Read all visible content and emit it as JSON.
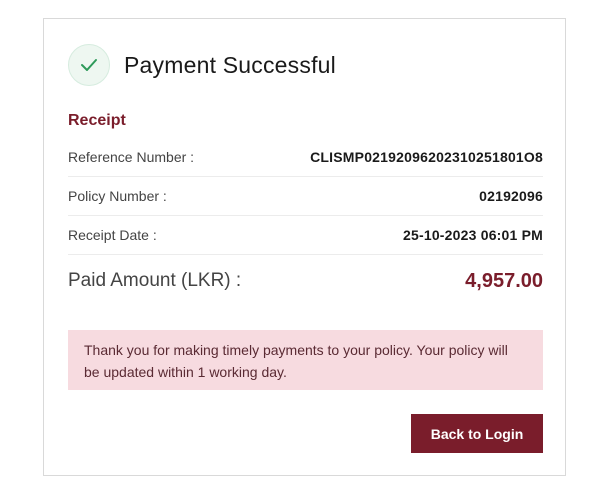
{
  "header": {
    "title": "Payment Successful",
    "icon": "check-icon",
    "icon_color": "#2e9a5a"
  },
  "receipt": {
    "label": "Receipt",
    "rows": [
      {
        "key": "Reference Number :",
        "value": "CLISMP02192096202310251801O8"
      },
      {
        "key": "Policy Number :",
        "value": "02192096"
      },
      {
        "key": "Receipt Date :",
        "value": "25-10-2023 06:01 PM"
      }
    ],
    "paid_label": "Paid Amount (LKR) :",
    "paid_value": "4,957.00"
  },
  "notice": {
    "text": "Thank you for making timely payments to your policy. Your policy will be updated within 1 working day."
  },
  "actions": {
    "back_label": "Back to Login"
  },
  "colors": {
    "accent": "#7a1d2b",
    "notice_bg": "#f7dbe0"
  }
}
